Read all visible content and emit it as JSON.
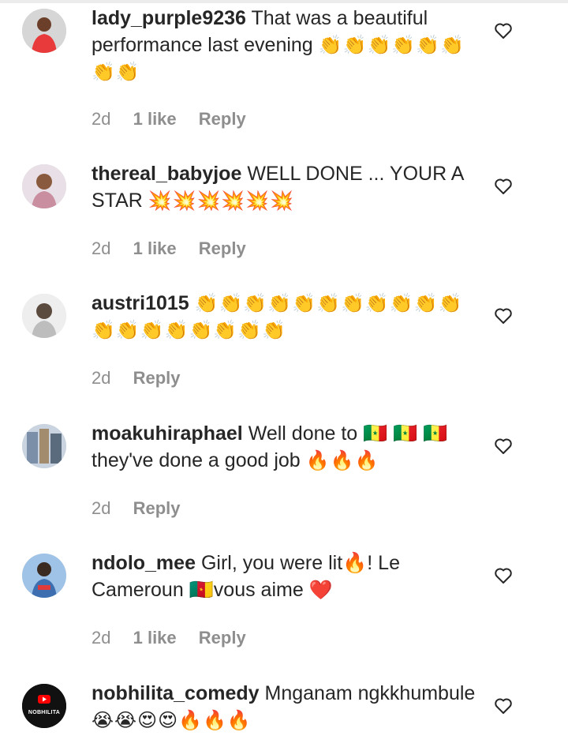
{
  "comments": [
    {
      "username": "lady_purple9236",
      "text": "That was a beautiful performance last evening",
      "emojis": "👏👏👏👏👏👏👏👏",
      "time": "2d",
      "likes": "1 like",
      "reply": "Reply",
      "avatar_color": "#e83a3a"
    },
    {
      "username": "thereal_babyjoe",
      "text": "WELL DONE ... YOUR A STAR",
      "emojis": "💥💥💥💥💥💥",
      "time": "2d",
      "likes": "1 like",
      "reply": "Reply",
      "avatar_color": "#c98fa0"
    },
    {
      "username": "austri1015",
      "text": "",
      "emojis": "👏👏👏👏👏👏👏👏👏👏👏👏👏👏👏👏👏👏👏",
      "time": "2d",
      "likes": "",
      "reply": "Reply",
      "avatar_color": "#cfcfcf"
    },
    {
      "username": "moakuhiraphael",
      "text": "Well done to 🇸🇳 🇸🇳 🇸🇳 they've done a good job",
      "emojis": "🔥🔥🔥",
      "time": "2d",
      "likes": "",
      "reply": "Reply",
      "avatar_color": "#7b8fa8"
    },
    {
      "username": "ndolo_mee",
      "text": "Girl, you were lit🔥! Le Cameroun 🇨🇲vous aime",
      "emojis": "❤️",
      "time": "2d",
      "likes": "1 like",
      "reply": "Reply",
      "avatar_color": "#3d6fb0"
    },
    {
      "username": "nobhilita_comedy",
      "text": "Mnganam ngkkhumbule",
      "emojis": "😭😭😍😍🔥🔥🔥",
      "time": "",
      "likes": "",
      "reply": "",
      "avatar_color": "#111111",
      "avatar_text": "NOBHILITA"
    }
  ],
  "icons": {
    "like": "heart-outline-icon",
    "avatar_badge": "youtube-icon"
  },
  "colors": {
    "text": "#262626",
    "meta": "#8e8e8e",
    "youtube_red": "#ff0000"
  }
}
